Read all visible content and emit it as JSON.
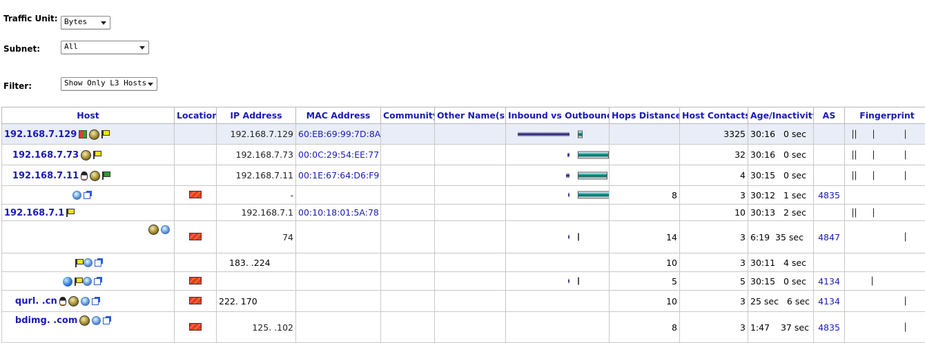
{
  "controls": {
    "traffic_unit": {
      "label": "Traffic Unit:",
      "value": "Bytes"
    },
    "subnet": {
      "label": "Subnet:",
      "value": "All"
    },
    "filter": {
      "label": "Filter:",
      "value": "Show Only L3 Hosts"
    }
  },
  "table": {
    "columns": [
      "Host",
      "Location",
      "IP Address",
      "MAC Address",
      "Community",
      "Other Name(s)",
      "Inbound vs Outbound",
      "Hops Distance",
      "Host Contacts",
      "Age/Inactivity",
      "AS",
      "Fingerprint"
    ],
    "rows": [
      {
        "host": "192.168.7.129",
        "ip": "192.168.7.129",
        "mac": "60:EB:69:99:7D:8A",
        "hops": "",
        "contacts": "3325",
        "age": "30:16",
        "inactivity": "0 sec",
        "as": "",
        "inbound": 0.85,
        "outbound": 0.15
      },
      {
        "host": "192.168.7.73",
        "ip": "192.168.7.73",
        "mac": "00:0C:29:54:EE:77",
        "hops": "",
        "contacts": "32",
        "age": "30:16",
        "inactivity": "0 sec",
        "as": "",
        "inbound": 0.03,
        "outbound": 0.97
      },
      {
        "host": "192.168.7.11",
        "ip": "192.168.7.11",
        "mac": "00:1E:67:64:D6:F9",
        "hops": "",
        "contacts": "4",
        "age": "30:15",
        "inactivity": "0 sec",
        "as": "",
        "inbound": 0.06,
        "outbound": 0.94
      },
      {
        "host": "",
        "ip": "-",
        "mac": "",
        "hops": "8",
        "contacts": "3",
        "age": "30:12",
        "inactivity": "1 sec",
        "as": "4835",
        "inbound": 0.01,
        "outbound": 0.99
      },
      {
        "host": "192.168.7.1",
        "ip": "192.168.7.1",
        "mac": "00:10:18:01:5A:78",
        "hops": "",
        "contacts": "10",
        "age": "30:13",
        "inactivity": "2 sec",
        "as": "",
        "inbound": 0,
        "outbound": 0
      },
      {
        "host": "",
        "ip": "74",
        "mac": "",
        "hops": "14",
        "contacts": "3",
        "age": "6:19",
        "inactivity": "35 sec",
        "as": "4847",
        "inbound": 0.01,
        "outbound": 0.01
      },
      {
        "host": "",
        "ip": "183.  .224",
        "mac": "",
        "hops": "10",
        "contacts": "3",
        "age": "30:11",
        "inactivity": "4 sec",
        "as": "",
        "inbound": 0,
        "outbound": 0
      },
      {
        "host": "",
        "ip": "",
        "mac": "",
        "hops": "5",
        "contacts": "5",
        "age": "30:15",
        "inactivity": "0 sec",
        "as": "4134",
        "inbound": 0.01,
        "outbound": 0.01
      },
      {
        "host": "qurl.  .cn",
        "ip": "222.  170",
        "mac": "",
        "hops": "10",
        "contacts": "3",
        "age": "25 sec",
        "inactivity": "6 sec",
        "as": "4134",
        "inbound": 0,
        "outbound": 0
      },
      {
        "host": "bdimg.  .com",
        "ip": "125.  .102",
        "mac": "",
        "hops": "8",
        "contacts": "3",
        "age": "1:47",
        "inactivity": "37 sec",
        "as": "4835",
        "inbound": 0,
        "outbound": 0
      }
    ]
  }
}
